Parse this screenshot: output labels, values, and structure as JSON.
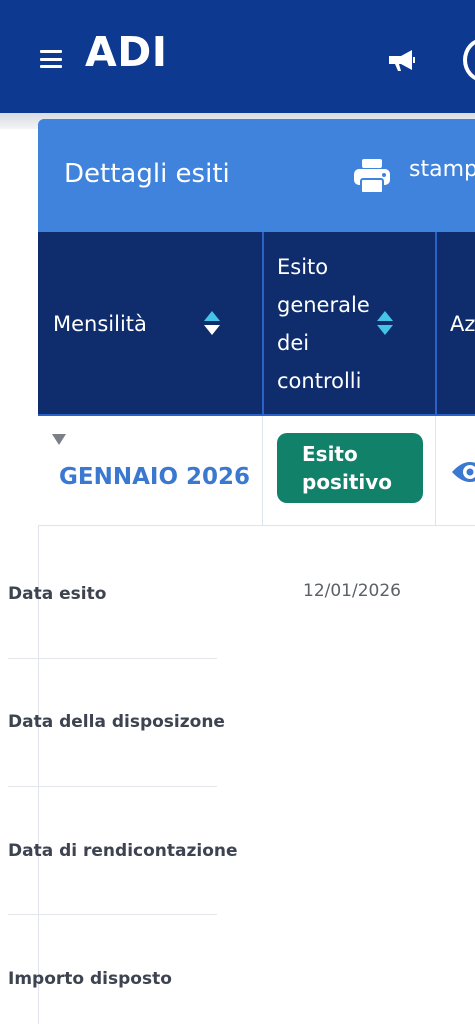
{
  "app": {
    "title": "ADI"
  },
  "card": {
    "title": "Dettagli esiti",
    "print_label": "stamp"
  },
  "table": {
    "headers": {
      "month": "Mensilità",
      "outcome": [
        "Esito",
        "generale",
        "dei",
        "controlli"
      ],
      "actions": "Az"
    },
    "rows": [
      {
        "month": "GENNAIO 2026",
        "status_line1": "Esito",
        "status_line2": "positivo",
        "status_color": "#11816a"
      }
    ]
  },
  "details": [
    {
      "label": "Data esito",
      "value": "12/01/2026"
    },
    {
      "label": "Data della disposizone",
      "value": ""
    },
    {
      "label": "Data di rendicontazione",
      "value": ""
    },
    {
      "label": "Importo disposto",
      "value": ""
    }
  ],
  "icons": {
    "menu": "hamburger-icon",
    "announcements": "megaphone-icon",
    "user": "user-circle-icon",
    "print": "printer-icon",
    "sort": "sort-icon",
    "view": "eye-icon",
    "expand": "caret-down-icon"
  },
  "colors": {
    "primary": "#0d3990",
    "header_blue": "#3f83dd",
    "table_header": "#0f2c6c",
    "link": "#3b78cf",
    "success": "#11816a",
    "sort_accent": "#44c4e6"
  }
}
